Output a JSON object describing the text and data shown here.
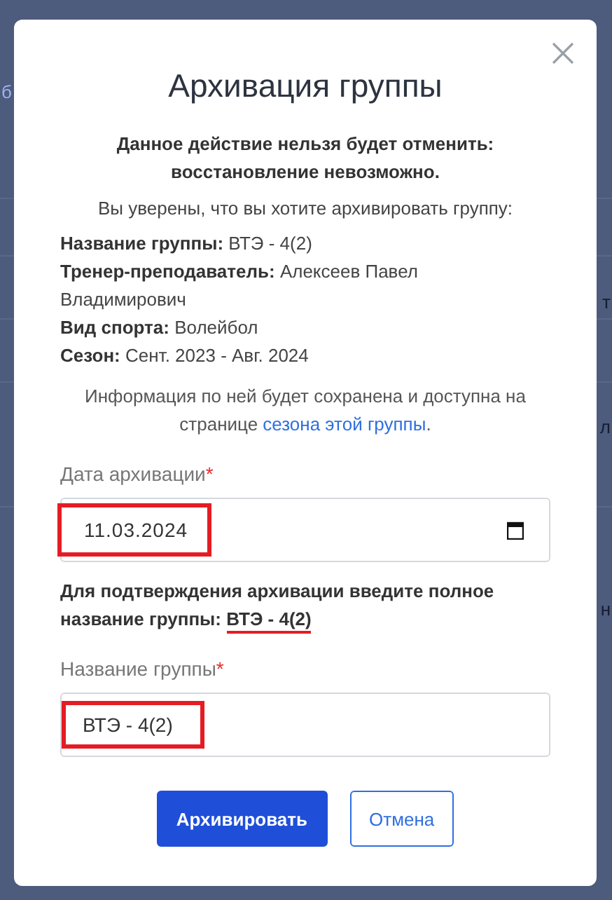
{
  "background": {
    "left_fragments": [
      "б"
    ],
    "right_fragments": [
      "т",
      "л",
      "н"
    ]
  },
  "dialog": {
    "title": "Архивация группы",
    "warning": "Данное действие нельзя будет отменить: восстановление невозможно.",
    "question": "Вы уверены, что вы хотите архивировать группу:",
    "details": [
      {
        "label": "Название группы:",
        "value": "ВТЭ - 4(2)"
      },
      {
        "label": "Тренер-преподаватель:",
        "value": "Алексеев Павел Владимирович"
      },
      {
        "label": "Вид спорта:",
        "value": "Волейбол"
      },
      {
        "label": "Сезон:",
        "value": "Сент. 2023 - Авг. 2024"
      }
    ],
    "info": "Информация по ней будет сохранена и доступна на странице",
    "info_link": "сезона этой группы",
    "info_end": ".",
    "date_field": {
      "label": "Дата архивации",
      "required_mark": "*",
      "value": "11.03.2024",
      "highlighted": true
    },
    "confirm_text": "Для подтверждения архивации введите полное название группы:",
    "confirm_name": {
      "text": "ВТЭ - 4(2)",
      "underlined": true
    },
    "name_field": {
      "label": "Название группы",
      "required_mark": "*",
      "value": "ВТЭ - 4(2)",
      "highlighted": true
    },
    "buttons": [
      {
        "label": "Архивировать",
        "kind": "primary"
      },
      {
        "label": "Отмена",
        "kind": "outline"
      }
    ]
  }
}
